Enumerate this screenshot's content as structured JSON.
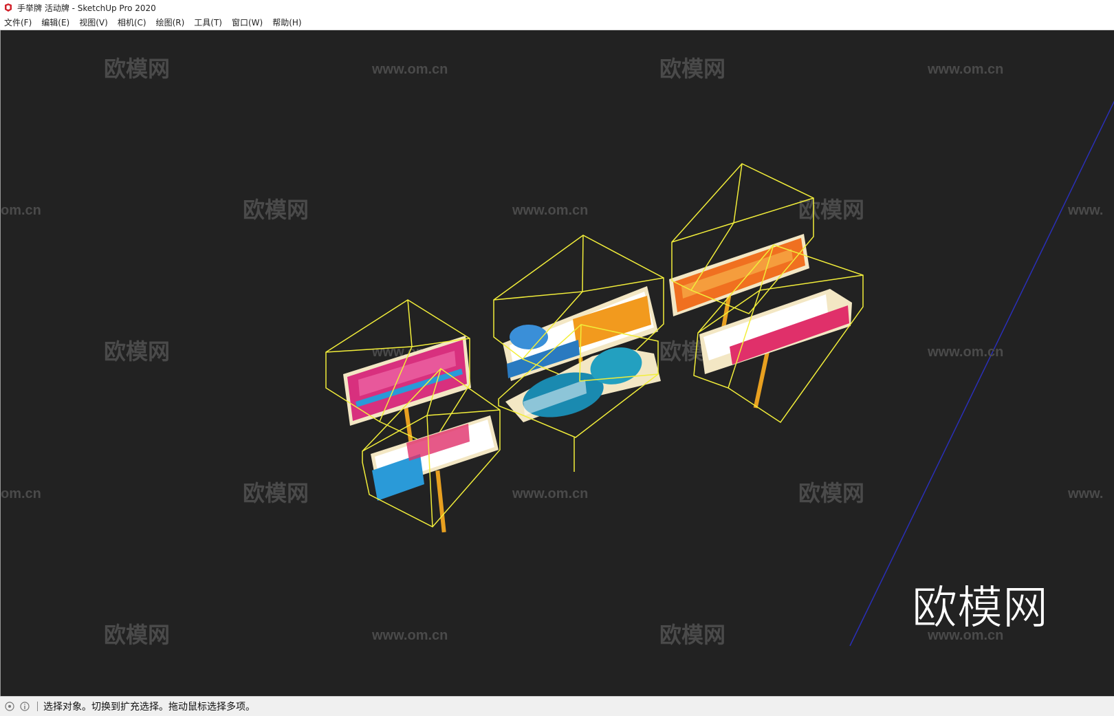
{
  "window": {
    "title": "手举牌 活动牌 - SketchUp Pro 2020"
  },
  "menu": [
    {
      "label": "文件(F)"
    },
    {
      "label": "编辑(E)"
    },
    {
      "label": "视图(V)"
    },
    {
      "label": "相机(C)"
    },
    {
      "label": "绘图(R)"
    },
    {
      "label": "工具(T)"
    },
    {
      "label": "窗口(W)"
    },
    {
      "label": "帮助(H)"
    }
  ],
  "watermark": {
    "brand": "欧模网",
    "url": "www.om.cn",
    "url_fragment_left": "om.cn",
    "url_fragment_right": "www."
  },
  "status": {
    "message": "选择对象。切换到扩充选择。拖动鼠标选择多项。"
  },
  "colors": {
    "viewport": "#222222",
    "selection": "#f2ee3a",
    "axis": "#2a2fb8"
  }
}
